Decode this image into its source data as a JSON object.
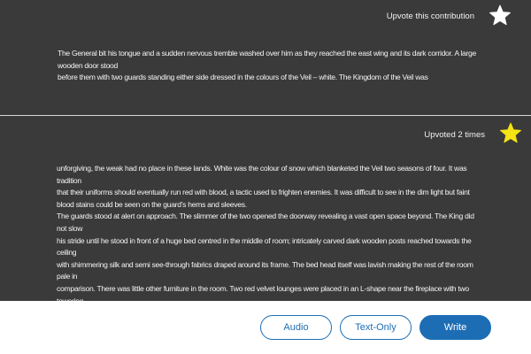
{
  "contributions": [
    {
      "vote_label": "Upvote this contribution",
      "star_icon": "star-outline-icon",
      "star_fill": "#ffffff",
      "text": "The General bit his tongue and a sudden nervous tremble washed over him as they reached the east wing and its dark corridor. A large wooden door stood\nbefore them with two guards standing either side dressed in the colours of the Veil – white. The Kingdom of the Veil was"
    },
    {
      "vote_label": "Upvoted 2 times",
      "star_icon": "star-filled-icon",
      "star_fill": "#f5e313",
      "text": "unforgiving, the weak had no place in these lands. White was the colour of snow which blanketed the Veil two seasons of four. It was tradition\n that their uniforms should eventually run red with blood, a tactic used to frighten enemies. It was difficult to see in the dim light but faint\nblood stains could be seen on the guard’s hems and sleeves.\nThe guards stood at alert on approach. The slimmer of the two opened the doorway revealing a vast open space beyond. The King did not slow\nhis stride until he stood in front of a huge bed centred in the middle of room; intricately carved dark wooden posts reached towards the ceiling\nwith shimmering silk and semi see-through fabrics draped around its frame. The bed head itself was lavish making the rest of the room pale in\ncomparison. There was little other furniture in the room. Two red velvet lounges were placed in an L-shape near the fireplace with two towering"
    }
  ],
  "footer": {
    "audio_label": "Audio",
    "textonly_label": "Text-Only",
    "write_label": "Write"
  },
  "colors": {
    "background": "#3a3a3a",
    "accent": "#1d6db5",
    "divider": "#d8d8d8"
  }
}
